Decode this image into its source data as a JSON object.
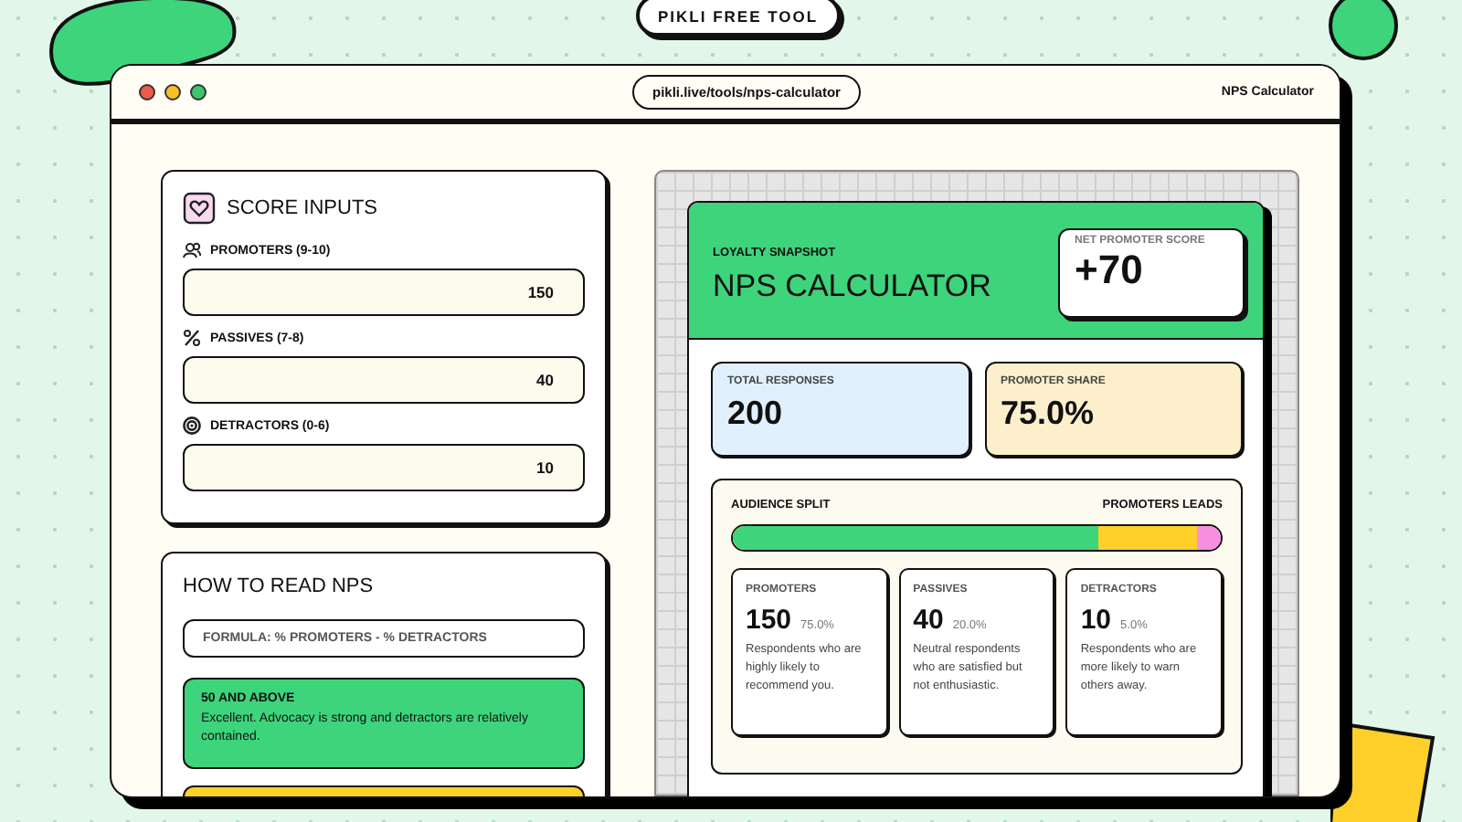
{
  "badge": "PIKLI FREE TOOL",
  "window": {
    "url": "pikli.live/tools/nps-calculator",
    "title": "NPS Calculator"
  },
  "inputs": {
    "title": "SCORE INPUTS",
    "fields": [
      {
        "kind": "people",
        "label": "PROMOTERS (9-10)",
        "value": "150"
      },
      {
        "kind": "percent",
        "label": "PASSIVES (7-8)",
        "value": "40"
      },
      {
        "kind": "target",
        "label": "DETRACTORS (0-6)",
        "value": "10"
      }
    ]
  },
  "guide": {
    "title": "HOW TO READ NPS",
    "formula": "FORMULA: % PROMOTERS - % DETRACTORS",
    "ranges": [
      {
        "title": "50 AND ABOVE",
        "text": "Excellent. Advocacy is strong and detractors are relatively contained.",
        "color": "#3dd47c"
      },
      {
        "color": "#ffd02a"
      }
    ]
  },
  "result": {
    "eyebrow": "LOYALTY SNAPSHOT",
    "title": "NPS CALCULATOR",
    "score_label": "NET PROMOTER SCORE",
    "score": "+70",
    "stats": [
      {
        "label": "TOTAL RESPONSES",
        "value": "200",
        "color": "#e1f0fd"
      },
      {
        "label": "PROMOTER SHARE",
        "value": "75.0%",
        "color": "#fdefcc"
      }
    ],
    "split": {
      "title": "AUDIENCE SPLIT",
      "verdict": "PROMOTERS LEADS",
      "bar": [
        {
          "level": 1,
          "color": "#f78fe0"
        },
        {
          "level": 0.95,
          "color": "#ffd02a"
        },
        {
          "level": 0.75,
          "color": "#3dd47c"
        }
      ],
      "segments": [
        {
          "name": "PROMOTERS",
          "count": "150",
          "share": "75.0%",
          "text": "Respondents who are highly likely to recommend you."
        },
        {
          "name": "PASSIVES",
          "count": "40",
          "share": "20.0%",
          "text": "Neutral respondents who are satisfied but not enthusiastic."
        },
        {
          "name": "DETRACTORS",
          "count": "10",
          "share": "5.0%",
          "text": "Respondents who are more likely to warn others away."
        }
      ]
    }
  }
}
